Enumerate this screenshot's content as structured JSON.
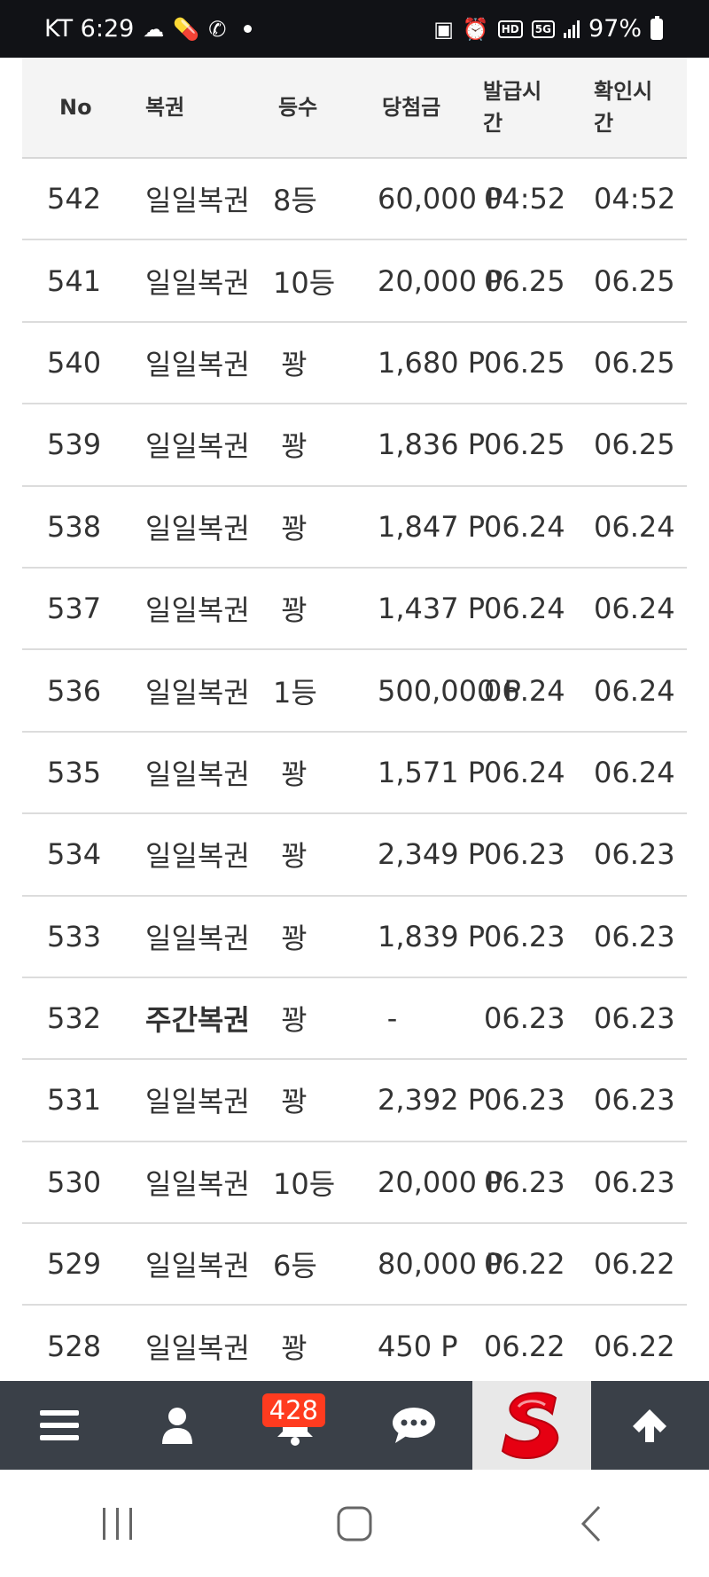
{
  "status_bar": {
    "carrier_time": "KT 6:29",
    "battery": "97%",
    "network": "5G",
    "hd": "HD"
  },
  "table": {
    "headers": {
      "no": "No",
      "type": "복권",
      "grade": "등수",
      "prize": "당첨금",
      "issue_line1": "발급시",
      "issue_line2": "간",
      "check_line1": "확인시",
      "check_line2": "간"
    },
    "rows": [
      {
        "no": "542",
        "type": "일일복권",
        "grade": "8등",
        "prize": "60,000 P",
        "issue": "04:52",
        "check": "04:52"
      },
      {
        "no": "541",
        "type": "일일복권",
        "grade": "10등",
        "prize": "20,000 P",
        "issue": "06.25",
        "check": "06.25"
      },
      {
        "no": "540",
        "type": "일일복권",
        "grade": "꽝",
        "prize": "1,680 P",
        "issue": "06.25",
        "check": "06.25"
      },
      {
        "no": "539",
        "type": "일일복권",
        "grade": "꽝",
        "prize": "1,836 P",
        "issue": "06.25",
        "check": "06.25"
      },
      {
        "no": "538",
        "type": "일일복권",
        "grade": "꽝",
        "prize": "1,847 P",
        "issue": "06.24",
        "check": "06.24"
      },
      {
        "no": "537",
        "type": "일일복권",
        "grade": "꽝",
        "prize": "1,437 P",
        "issue": "06.24",
        "check": "06.24"
      },
      {
        "no": "536",
        "type": "일일복권",
        "grade": "1등",
        "prize": "500,000 P",
        "issue": "06.24",
        "check": "06.24"
      },
      {
        "no": "535",
        "type": "일일복권",
        "grade": "꽝",
        "prize": "1,571 P",
        "issue": "06.24",
        "check": "06.24"
      },
      {
        "no": "534",
        "type": "일일복권",
        "grade": "꽝",
        "prize": "2,349 P",
        "issue": "06.23",
        "check": "06.23"
      },
      {
        "no": "533",
        "type": "일일복권",
        "grade": "꽝",
        "prize": "1,839 P",
        "issue": "06.23",
        "check": "06.23"
      },
      {
        "no": "532",
        "type": "주간복권",
        "grade": "꽝",
        "prize": "-",
        "issue": "06.23",
        "check": "06.23"
      },
      {
        "no": "531",
        "type": "일일복권",
        "grade": "꽝",
        "prize": "2,392 P",
        "issue": "06.23",
        "check": "06.23"
      },
      {
        "no": "530",
        "type": "일일복권",
        "grade": "10등",
        "prize": "20,000 P",
        "issue": "06.23",
        "check": "06.23"
      },
      {
        "no": "529",
        "type": "일일복권",
        "grade": "6등",
        "prize": "80,000 P",
        "issue": "06.22",
        "check": "06.22"
      },
      {
        "no": "528",
        "type": "일일복권",
        "grade": "꽝",
        "prize": "450 P",
        "issue": "06.22",
        "check": "06.22"
      }
    ]
  },
  "bottom_nav": {
    "items": [
      {
        "icon": "menu-icon"
      },
      {
        "icon": "user-icon"
      },
      {
        "icon": "bell-icon",
        "badge": "428"
      },
      {
        "icon": "chat-icon"
      },
      {
        "icon": "site-logo"
      },
      {
        "icon": "arrow-up-icon"
      }
    ],
    "badge_count": "428"
  },
  "colors": {
    "status_bar_bg": "#111216",
    "header_bg": "#f4f4f4",
    "nav_bg": "#3a4048",
    "badge_bg": "#ff3b1f",
    "logo_red": "#e60012"
  }
}
